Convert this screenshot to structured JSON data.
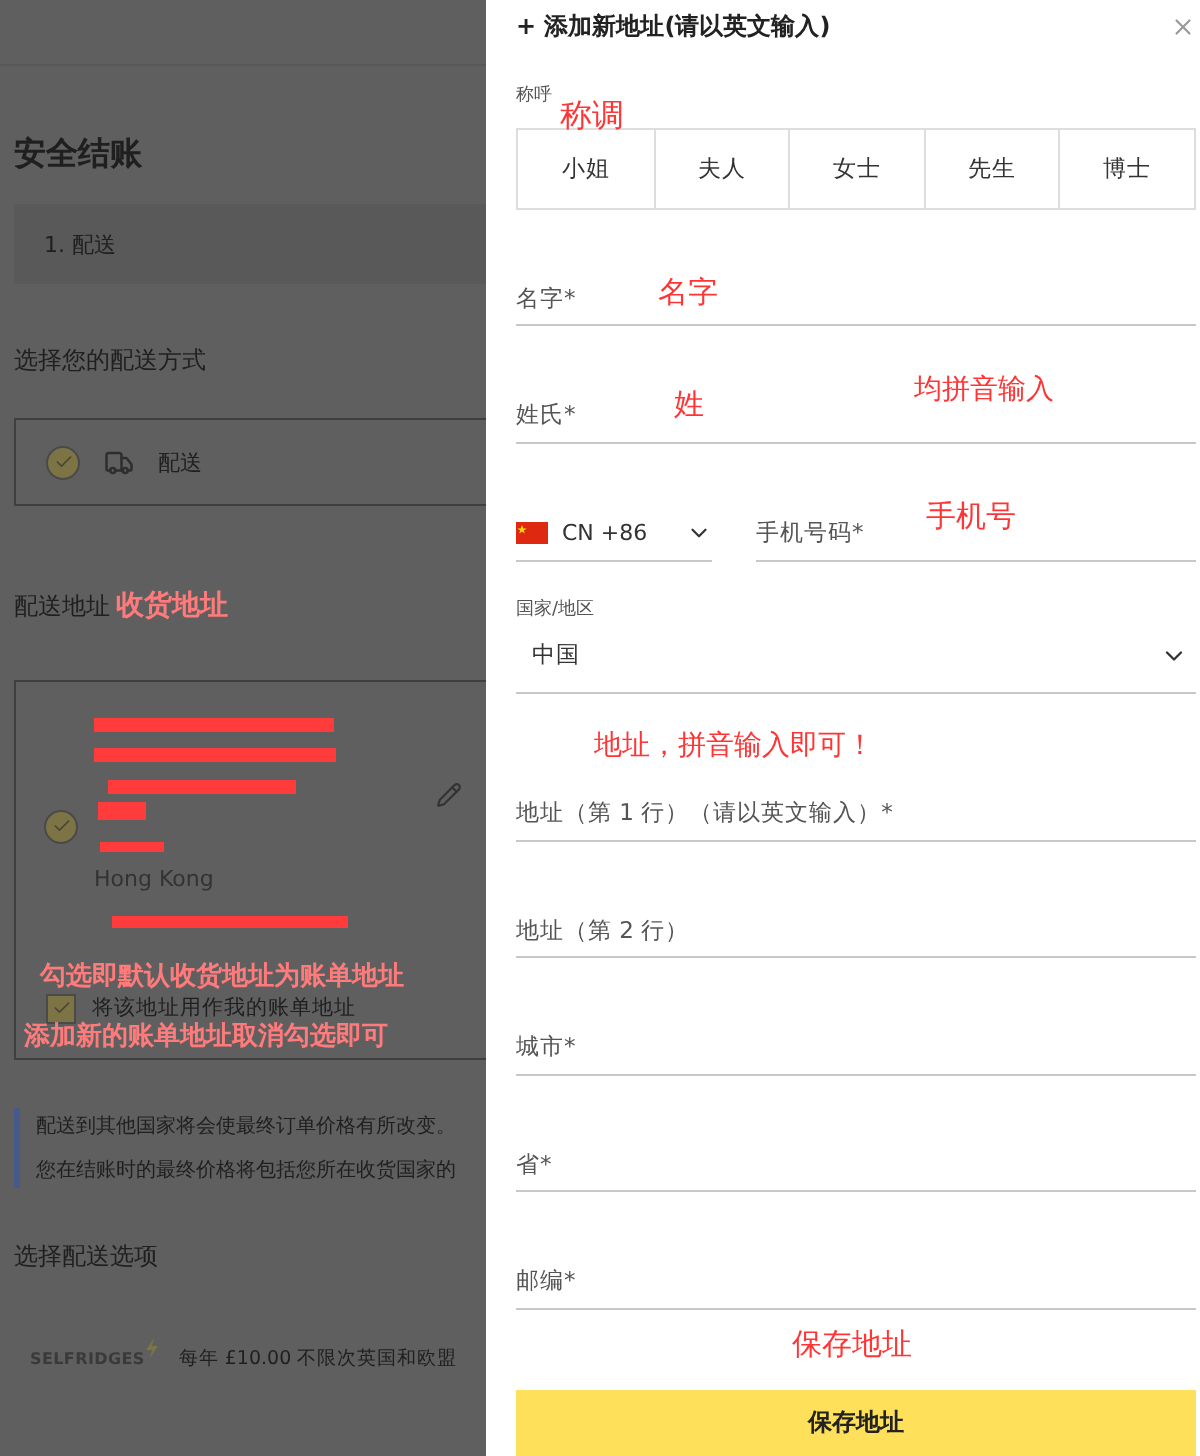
{
  "checkout": {
    "title": "安全结账",
    "step": "1. 配送",
    "delivery_method_heading": "选择您的配送方式",
    "delivery_option": {
      "label": "配送",
      "selected": true
    },
    "address_heading": "配送地址",
    "address_card": {
      "selected": true,
      "city": "Hong Kong"
    },
    "billing_checkbox": {
      "label": "将该地址用作我的账单地址",
      "checked": true
    },
    "notice": {
      "lines": [
        "配送到其他国家将会使最终订单价格有所改变。",
        "您在结账时的最终价格将包括您所在收货国家的"
      ]
    },
    "delivery_options_heading": "选择配送选项",
    "membership": {
      "logo": "SELFRIDGES",
      "text": "每年 £10.00 不限次英国和欧盟"
    }
  },
  "drawer": {
    "title": "+ 添加新地址(请以英文输入)",
    "salutation_label": "称呼",
    "salutations": [
      {
        "label": "小姐",
        "selected": false
      },
      {
        "label": "夫人",
        "selected": false
      },
      {
        "label": "女士",
        "selected": false
      },
      {
        "label": "先生",
        "selected": false
      },
      {
        "label": "博士",
        "selected": false
      }
    ],
    "fields_top": [
      {
        "placeholder": "名字*"
      },
      {
        "placeholder": "姓氏*"
      }
    ],
    "phone": {
      "country_code": "CN +86",
      "placeholder": "手机号码*"
    },
    "country": {
      "label": "国家/地区",
      "value": "中国"
    },
    "fields_bottom": [
      {
        "placeholder": "地址（第 1 行）（请以英文输入）*"
      },
      {
        "placeholder": "地址（第 2 行）"
      },
      {
        "placeholder": "城市*"
      },
      {
        "placeholder": "省*"
      },
      {
        "placeholder": "邮编*"
      }
    ],
    "save_button": "保存地址"
  },
  "annotations": [
    "收货地址",
    "勾选即默认收货地址为账单地址",
    "添加新的账单地址取消勾选即可",
    "称调",
    "名字",
    "姓",
    "均拼音输入",
    "手机号",
    "地址，拼音输入即可！",
    "保存地址"
  ]
}
